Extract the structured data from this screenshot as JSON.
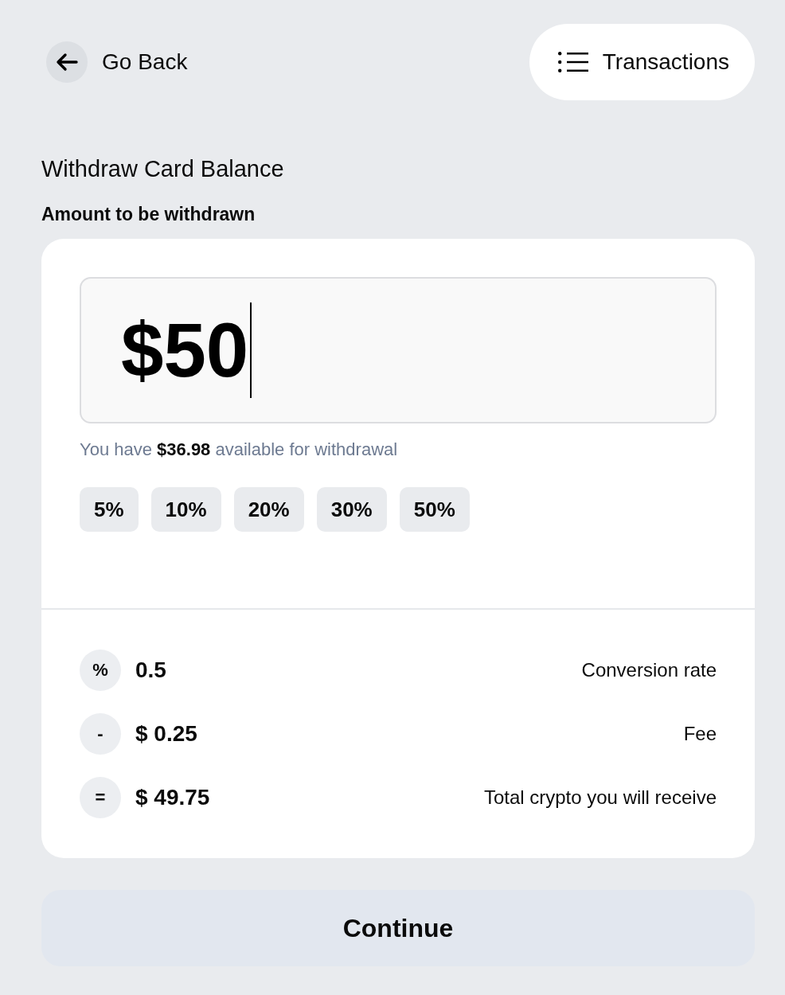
{
  "header": {
    "back_button": {
      "label": "Go Back"
    },
    "transactions_button": {
      "label": "Transactions"
    }
  },
  "title": "Withdraw Card Balance",
  "amount_label": "Amount to be withdrawn",
  "amount_input": {
    "value": "$50",
    "focused": true
  },
  "available_note": "You have **$36.98** available for withdrawal",
  "presets": [
    {
      "label": "5%",
      "selected": false
    },
    {
      "label": "10%",
      "selected": false
    },
    {
      "label": "20%",
      "selected": false
    },
    {
      "label": "30%",
      "selected": false
    },
    {
      "label": "50%",
      "selected": false
    }
  ],
  "summary": [
    {
      "symbol": "%",
      "value": "0.5",
      "label": "Conversion rate"
    },
    {
      "symbol": "-",
      "value": "$ 0.25",
      "label": "Fee"
    },
    {
      "symbol": "=",
      "value": "$ 49.75",
      "label": "Total crypto you will receive"
    }
  ],
  "continue_button": {
    "label": "Continue"
  }
}
